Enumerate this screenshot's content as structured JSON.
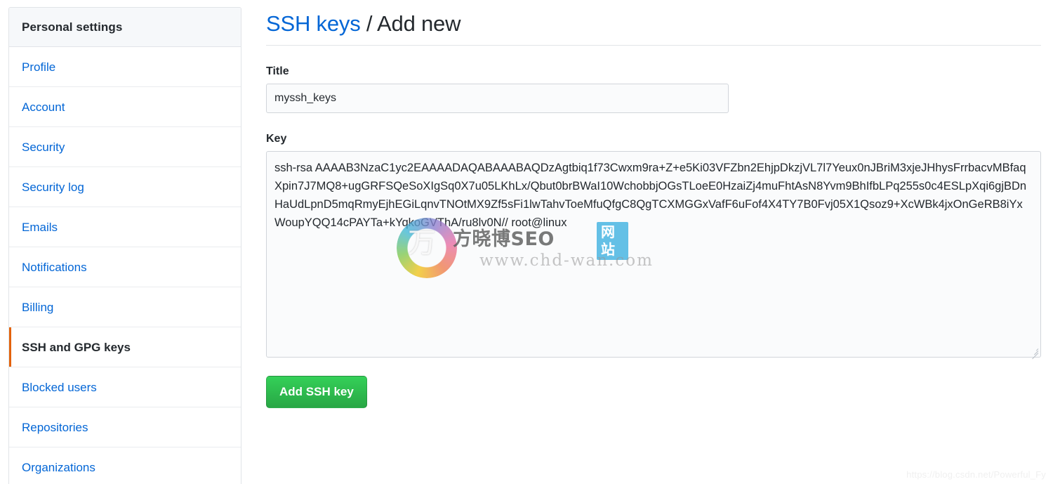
{
  "sidebar": {
    "header": "Personal settings",
    "items": [
      {
        "label": "Profile",
        "selected": false
      },
      {
        "label": "Account",
        "selected": false
      },
      {
        "label": "Security",
        "selected": false
      },
      {
        "label": "Security log",
        "selected": false
      },
      {
        "label": "Emails",
        "selected": false
      },
      {
        "label": "Notifications",
        "selected": false
      },
      {
        "label": "Billing",
        "selected": false
      },
      {
        "label": "SSH and GPG keys",
        "selected": true
      },
      {
        "label": "Blocked users",
        "selected": false
      },
      {
        "label": "Repositories",
        "selected": false
      },
      {
        "label": "Organizations",
        "selected": false
      }
    ],
    "accent_color": "#e36209",
    "link_color": "#0366d6"
  },
  "header": {
    "breadcrumb_link": "SSH keys",
    "breadcrumb_separator": "/",
    "breadcrumb_current": "Add new"
  },
  "form": {
    "title_label": "Title",
    "title_value": "myssh_keys",
    "title_placeholder": "",
    "key_label": "Key",
    "key_value": "ssh-rsa AAAAB3NzaC1yc2EAAAADAQABAAABAQDzAgtbiq1f73Cwxm9ra+Z+e5Ki03VFZbn2EhjpDkzjVL7l7Yeux0nJBriM3xjeJHhysFrrbacvMBfaqXpin7J7MQ8+ugGRFSQeSoXIgSq0X7u05LKhLx/Qbut0brBWaI10WchobbjOGsTLoeE0HzaiZj4muFhtAsN8Yvm9BhIfbLPq255s0c4ESLpXqi6gjBDnHaUdLpnD5mqRmyEjhEGiLqnvTNOtMX9Zf5sFi1lwTahvToeMfuQfgC8QgTCXMGGxVafF6uFof4X4TY7B0Fvj05X1Qsoz9+XcWBk4jxOnGeRB8iYxWoupYQQ14cPAYTa+kYqkoGVThA/ru8lv0N// root@linux",
    "key_placeholder": "",
    "submit_label": "Add SSH key",
    "submit_color": "#28a745"
  },
  "watermark": {
    "ring_glyph": "万",
    "brand": "方晓博SEO",
    "badge": "网站",
    "url": "www.chd-wan.com",
    "corner": "https://blog.csdn.net/Powerful_Fy"
  }
}
